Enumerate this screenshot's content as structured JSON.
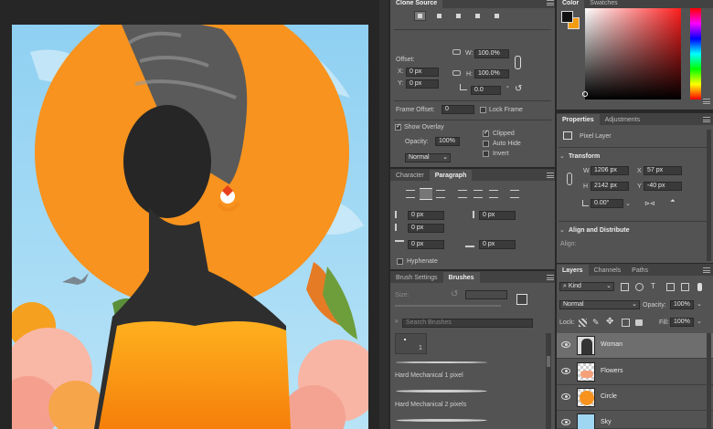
{
  "clone_source": {
    "tab_label": "Clone Source",
    "offset_label": "Offset:",
    "x_label": "X:",
    "x_value": "0 px",
    "y_label": "Y:",
    "y_value": "0 px",
    "w_label": "W:",
    "w_value": "100.0%",
    "h_label": "H:",
    "h_value": "100.0%",
    "angle_value": "0.0",
    "angle_unit": "°",
    "frame_offset_label": "Frame Offset:",
    "frame_offset_value": "0",
    "lock_frame_label": "Lock Frame",
    "show_overlay_label": "Show Overlay",
    "opacity_label": "Opacity:",
    "opacity_value": "100%",
    "clipped_label": "Clipped",
    "auto_hide_label": "Auto Hide",
    "invert_label": "Invert",
    "blend_mode_value": "Normal"
  },
  "char_para": {
    "tab_character": "Character",
    "tab_paragraph": "Paragraph",
    "indent_left_value": "0 px",
    "indent_right_value": "0 px",
    "indent_first_value": "0 px",
    "space_before_value": "0 px",
    "space_after_value": "0 px",
    "hyphenate_label": "Hyphenate"
  },
  "brushes": {
    "tab_settings": "Brush Settings",
    "tab_brushes": "Brushes",
    "size_label": "Size:",
    "search_placeholder": "Search Brushes",
    "preset_size": "1",
    "items": [
      "Hard Mechanical 1 pixel",
      "Hard Mechanical 2 pixels"
    ]
  },
  "color": {
    "tab_color": "Color",
    "tab_swatches": "Swatches",
    "foreground": "#111111",
    "background": "#f39c12",
    "accent": "#ff2020"
  },
  "properties": {
    "tab_properties": "Properties",
    "tab_adjustments": "Adjustments",
    "kind_label": "Pixel Layer",
    "transform_label": "Transform",
    "w_label": "W",
    "w_value": "1206 px",
    "x_label": "X",
    "x_value": "57 px",
    "h_label": "H",
    "h_value": "2142 px",
    "y_label": "Y",
    "y_value": "-40 px",
    "angle_value": "0.00°",
    "align_label": "Align and Distribute",
    "align_sub": "Align:"
  },
  "layers": {
    "tab_layers": "Layers",
    "tab_channels": "Channels",
    "tab_paths": "Paths",
    "filter_value": "Kind",
    "blend_value": "Normal",
    "opacity_label": "Opacity:",
    "opacity_value": "100%",
    "lock_label": "Lock:",
    "fill_label": "Fill:",
    "fill_value": "100%",
    "items": [
      {
        "name": "Woman"
      },
      {
        "name": "Flowers"
      },
      {
        "name": "Circle"
      },
      {
        "name": "Sky"
      }
    ]
  }
}
